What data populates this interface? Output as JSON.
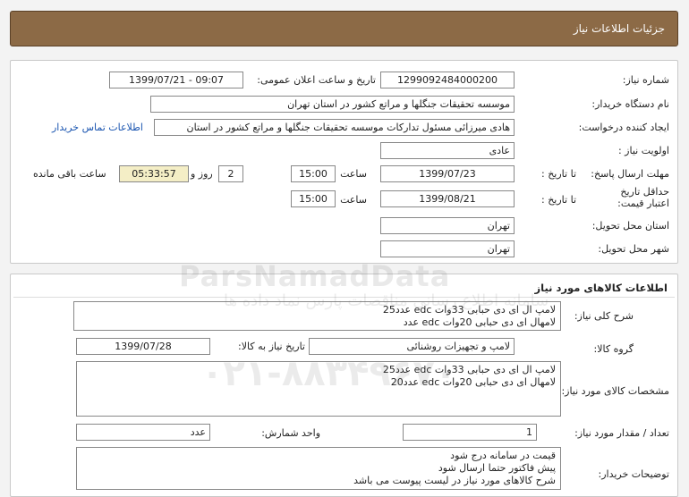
{
  "header": {
    "title": "جزئیات اطلاعات نیاز"
  },
  "info": {
    "need_number": {
      "label": "شماره نیاز:",
      "value": "1299092484000200"
    },
    "announce": {
      "label": "تاریخ و ساعت اعلان عمومی:",
      "value": "1399/07/21 - 09:07"
    },
    "buyer": {
      "label": "نام دستگاه خریدار:",
      "value": "موسسه تحقیقات جنگلها و مراتع کشور در استان تهران"
    },
    "requester": {
      "label": "ایجاد کننده درخواست:",
      "value": "هادی میرزائی مسئول تدارکات موسسه تحقیقات جنگلها و مراتع کشور در استان",
      "contact_link": "اطلاعات تماس خریدار"
    },
    "priority": {
      "label": "اولویت نیاز :",
      "value": "عادی"
    },
    "response_deadline": {
      "label": "مهلت ارسال پاسخ:",
      "to_date_label": "تا تاریخ :",
      "date": "1399/07/23",
      "time_label": "ساعت",
      "time": "15:00",
      "days": "2",
      "day_and": "روز و",
      "remaining": "05:33:57",
      "remaining_label": "ساعت باقی مانده"
    },
    "price_validity": {
      "label": "حداقل تاریخ اعتبار قیمت:",
      "to_date_label": "تا تاریخ :",
      "date": "1399/08/21",
      "time_label": "ساعت",
      "time": "15:00"
    },
    "delivery_province": {
      "label": "استان محل تحویل:",
      "value": "تهران"
    },
    "delivery_city": {
      "label": "شهر محل تحویل:",
      "value": "تهران"
    }
  },
  "goods": {
    "title": "اطلاعات کالاهای مورد نیاز",
    "summary": {
      "label": "شرح کلی نیاز:",
      "lines": [
        "لامپ ال ای دی حبابی 33وات edc عدد25",
        "لامهال ای دی حبابی 20وات edc عدد"
      ]
    },
    "group": {
      "label": "گروه کالا:",
      "value": "لامپ و تجهیزات روشنائی"
    },
    "need_date": {
      "label": "تاریخ نیاز به کالا:",
      "value": "1399/07/28"
    },
    "specs": {
      "label": "مشخصات کالای مورد نیاز:",
      "lines": [
        "لامپ ال ای دی حبابی 33وات edc عدد25",
        "لامهال ای دی حبابی 20وات edc عدد20"
      ]
    },
    "quantity": {
      "label": "تعداد / مقدار مورد نیاز:",
      "value": "1"
    },
    "unit": {
      "label": "واحد شمارش:",
      "value": "عدد"
    },
    "buyer_notes": {
      "label": "توضیحات خریدار:",
      "lines": [
        "قیمت در سامانه درج شود",
        "پیش فاکتور حتما ارسال شود",
        "شرح کالاهای مورد نیاز در لیست پیوست می باشد"
      ]
    }
  },
  "watermark": {
    "brand": "ParsNamadData",
    "persian": "سامانه اطلاع رسانی مناقصات پارس نماد داده ها",
    "phone": "۰۲۱-۸۸۳۴۹۶۷۰"
  }
}
